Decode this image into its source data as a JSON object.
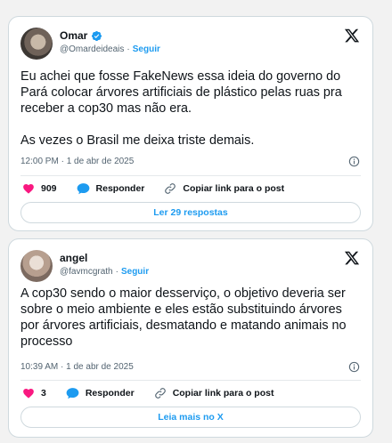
{
  "tweets": [
    {
      "author_name": "Omar",
      "handle": "@Omardeideais",
      "follow_label": "Seguir",
      "separator": "·",
      "text": "Eu achei que fosse FakeNews essa ideia do governo do Pará colocar árvores artificiais de plástico pelas ruas pra receber a cop30 mas não era.\n\nAs vezes o Brasil me deixa triste demais.",
      "timestamp": "12:00 PM · 1 de abr de 2025",
      "likes": "909",
      "reply_label": "Responder",
      "copy_label": "Copiar link para o post",
      "button_label": "Ler 29 respostas",
      "verified": true
    },
    {
      "author_name": "angel",
      "handle": "@favmcgrath",
      "follow_label": "Seguir",
      "separator": "·",
      "text": "A cop30 sendo o maior desserviço, o objetivo deveria ser sobre o meio ambiente e eles estão substituindo árvores por árvores artificiais, desmatando e matando animais no processo",
      "timestamp": "10:39 AM · 1 de abr de 2025",
      "likes": "3",
      "reply_label": "Responder",
      "copy_label": "Copiar link para o post",
      "button_label": "Leia mais no X",
      "verified": false
    }
  ],
  "colors": {
    "accent": "#1d9bf0",
    "like": "#f91880",
    "text": "#0f1419",
    "muted": "#536471",
    "border": "#cfd9de"
  },
  "icons": [
    "x-logo-icon",
    "verified-badge-icon",
    "info-icon",
    "heart-icon",
    "reply-bubble-icon",
    "link-icon"
  ]
}
